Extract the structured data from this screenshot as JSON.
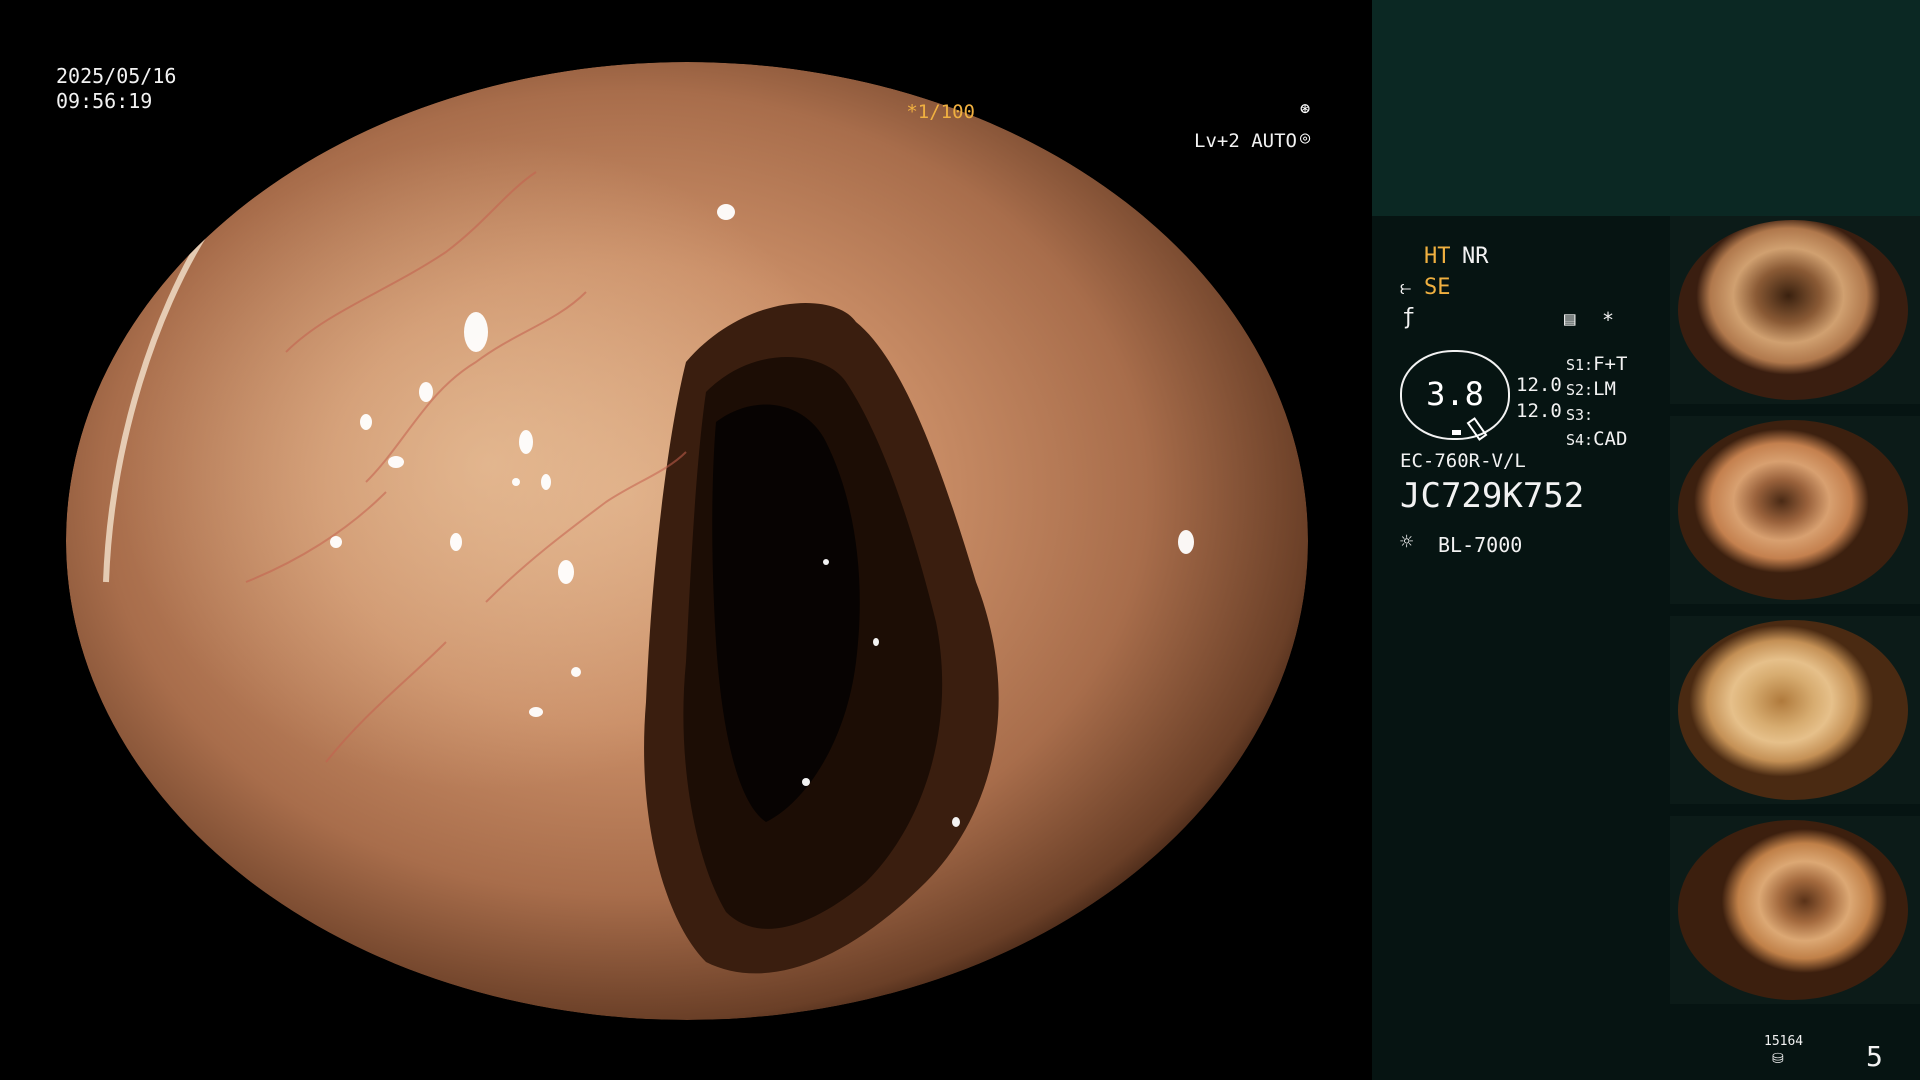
{
  "overlay": {
    "date": "2025/05/16",
    "time": "09:56:19",
    "shutter": "*1/100",
    "shutter_icon": "aperture-icon",
    "level": "Lv+2 AUTO",
    "auto_icon": "auto-iris-icon"
  },
  "panel": {
    "ht": "HT",
    "nr": "NR",
    "se": "SE",
    "se_icon": "structure-enhance-icon",
    "f_icon": "freeze-icon",
    "mem_icon": "memory-icon",
    "star": "*",
    "gauge_value": "3.8",
    "value1": "12.0",
    "value2": "12.0",
    "settings": [
      {
        "key": "S1:",
        "value": "F+T"
      },
      {
        "key": "S2:",
        "value": "LM"
      },
      {
        "key": "S3:",
        "value": ""
      },
      {
        "key": "S4:",
        "value": "CAD"
      }
    ],
    "scope_model": "EC-760R-V/L",
    "serial": "JC729K752",
    "light_icon": "light-bulb-icon",
    "light_source": "BL-7000",
    "footer_number": "15164",
    "footer_icon": "storage-icon",
    "count": "5"
  },
  "thumbnails": [
    {
      "name": "thumbnail-1"
    },
    {
      "name": "thumbnail-2"
    },
    {
      "name": "thumbnail-3"
    },
    {
      "name": "thumbnail-4"
    }
  ]
}
